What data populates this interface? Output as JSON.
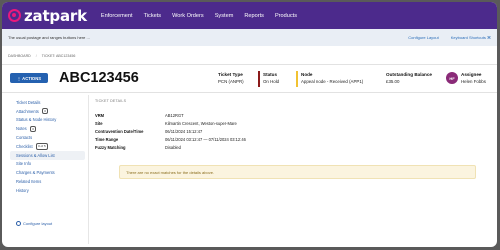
{
  "app": {
    "name": "zatpark"
  },
  "topnav": {
    "items": [
      "Enforcement",
      "Tickets",
      "Work Orders",
      "System",
      "Reports",
      "Products"
    ]
  },
  "subbar": {
    "message": "The usual postage and ranges buttons here ...",
    "configure_layout": "Configure Layout",
    "keyboard_shortcuts": "Keyboard Shortcuts ⌘"
  },
  "breadcrumb": {
    "home": "DASHBOARD",
    "current": "TICKET: ABC123456"
  },
  "header": {
    "actions_label": "⋮  ACTIONS",
    "ticket_number": "ABC123456",
    "ticket_type": {
      "label": "Ticket Type",
      "value": "PCN (ANPR)"
    },
    "status": {
      "label": "Status",
      "value": "On Hold",
      "color": "#8b1a1a"
    },
    "node": {
      "label": "Node",
      "value": "Appeal node - Received (APP1)",
      "color": "#f1c232"
    },
    "outstanding": {
      "label": "Outstanding Balance",
      "value": "£35.00"
    },
    "assignee": {
      "label": "Assignee",
      "value": "Helen Fobbs",
      "initials": "HF"
    }
  },
  "sidebar": {
    "items": [
      {
        "label": "Ticket Details"
      },
      {
        "label": "Attachments",
        "badge": "0"
      },
      {
        "label": "Status & Node History"
      },
      {
        "label": "Notes",
        "badge": "0"
      },
      {
        "label": "Contacts"
      },
      {
        "label": "Checklist",
        "badge": "0 of 5"
      },
      {
        "label": "Sessions & Allow List",
        "active": true
      },
      {
        "label": "Site Info"
      },
      {
        "label": "Charges & Payments"
      },
      {
        "label": "Related Items"
      },
      {
        "label": "History"
      }
    ],
    "configure_layout": "Configure layout"
  },
  "details": {
    "section_title": "TICKET DETAILS",
    "fields": [
      {
        "label": "VRM",
        "value": "AB12RGT"
      },
      {
        "label": "Site",
        "value": "Kilmartin Crescent, Weston-super-Mare"
      },
      {
        "label": "Contravention Date/Time",
        "value": "06/11/2024 15:12:47"
      },
      {
        "label": "Time Range",
        "value": "06/11/2024 03:12:47 — 07/11/2024 03:12:46"
      },
      {
        "label": "Fuzzy Matching",
        "value": "Disabled"
      }
    ],
    "notice": "There are no exact matches for the details above."
  }
}
